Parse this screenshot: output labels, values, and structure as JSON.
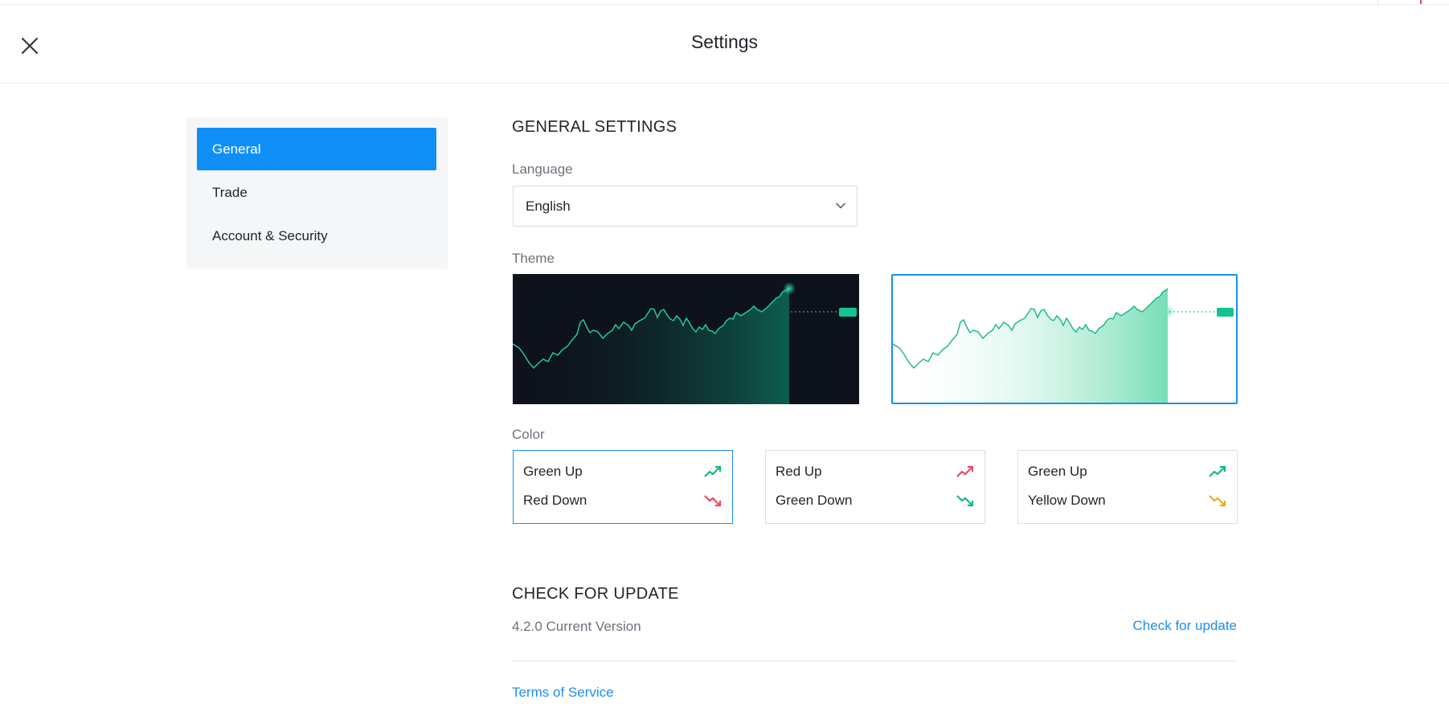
{
  "header": {
    "title": "Settings"
  },
  "sidebar": {
    "items": [
      {
        "label": "General",
        "active": true
      },
      {
        "label": "Trade",
        "active": false
      },
      {
        "label": "Account & Security",
        "active": false
      }
    ]
  },
  "general": {
    "title": "GENERAL SETTINGS",
    "language": {
      "label": "Language",
      "value": "English"
    },
    "theme": {
      "label": "Theme",
      "options": [
        "dark",
        "light"
      ],
      "selected": "light"
    },
    "color": {
      "label": "Color",
      "options": [
        {
          "up": "Green Up",
          "down": "Red Down",
          "up_color": "#10b981",
          "down_color": "#ef4565",
          "selected": true
        },
        {
          "up": "Red Up",
          "down": "Green Down",
          "up_color": "#ef4565",
          "down_color": "#10b981",
          "selected": false
        },
        {
          "up": "Green Up",
          "down": "Yellow Down",
          "up_color": "#10b981",
          "down_color": "#f0a91c",
          "selected": false
        }
      ]
    }
  },
  "update": {
    "title": "CHECK FOR UPDATE",
    "version": "4.2.0 Current Version",
    "check_label": "Check for update"
  },
  "footer": {
    "terms": "Terms of Service"
  },
  "colors": {
    "accent": "#0f8ff6",
    "positive": "#10b981",
    "negative": "#ef4565",
    "warning": "#f0a91c"
  }
}
